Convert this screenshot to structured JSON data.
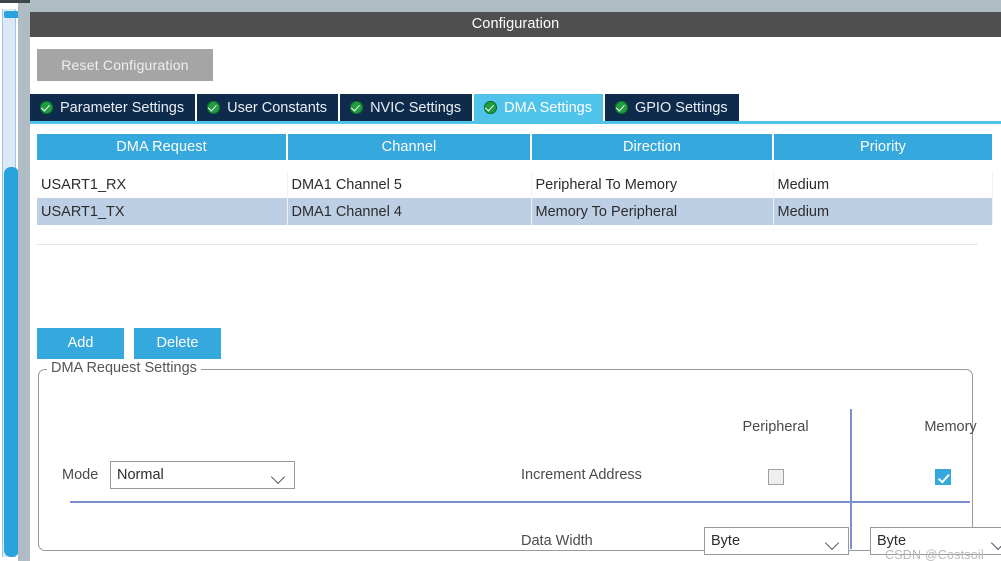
{
  "window": {
    "title": "Configuration"
  },
  "toolbar": {
    "reset_label": "Reset Configuration"
  },
  "tabs": [
    {
      "label": "Parameter Settings",
      "icon": "check-circle-icon",
      "active": false
    },
    {
      "label": "User Constants",
      "icon": "check-circle-icon",
      "active": false
    },
    {
      "label": "NVIC Settings",
      "icon": "check-circle-icon",
      "active": false
    },
    {
      "label": "DMA Settings",
      "icon": "check-circle-icon",
      "active": true
    },
    {
      "label": "GPIO Settings",
      "icon": "check-circle-icon",
      "active": false
    }
  ],
  "table": {
    "columns": [
      "DMA Request",
      "Channel",
      "Direction",
      "Priority"
    ],
    "rows": [
      {
        "selected": false,
        "cells": [
          "USART1_RX",
          "DMA1 Channel 5",
          "Peripheral To Memory",
          "Medium"
        ]
      },
      {
        "selected": true,
        "cells": [
          "USART1_TX",
          "DMA1 Channel 4",
          "Memory To Peripheral",
          "Medium"
        ]
      }
    ]
  },
  "actions": {
    "add_label": "Add",
    "delete_label": "Delete"
  },
  "settings": {
    "group_title": "DMA Request Settings",
    "col_peripheral": "Peripheral",
    "col_memory": "Memory",
    "mode_label": "Mode",
    "mode_value": "Normal",
    "increment_label": "Increment Address",
    "increment_peripheral_checked": "false",
    "increment_memory_checked": "true",
    "datawidth_label": "Data Width",
    "datawidth_peripheral_value": "Byte",
    "datawidth_memory_value": "Byte"
  },
  "watermark": {
    "text": "CSDN @Costsoil"
  },
  "colors": {
    "accent_blue": "#35a8dd",
    "tab_active": "#4fc3ea",
    "tab_inactive": "#0f2b4c",
    "header_gray": "#4f4f4f",
    "row_selected": "#bdcfe4",
    "check_green": "#1f9d3f",
    "divider_blue": "#7d8fd0"
  }
}
